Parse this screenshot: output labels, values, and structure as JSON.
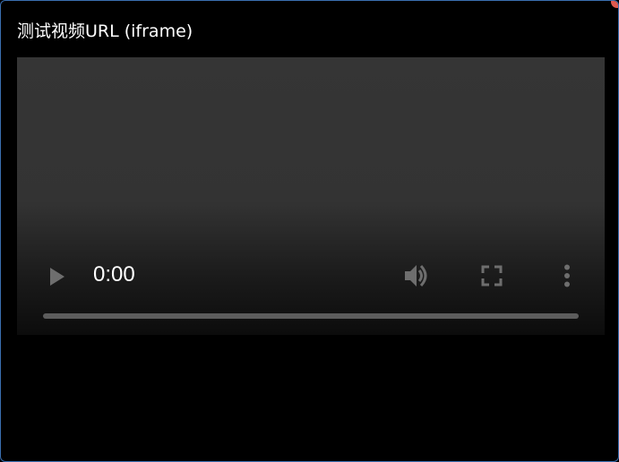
{
  "window": {
    "title": "测试视频URL (iframe)"
  },
  "player": {
    "current_time": "0:00",
    "progress": 0,
    "icons": {
      "play": "play-icon",
      "volume": "volume-icon",
      "fullscreen": "fullscreen-icon",
      "more": "more-options-icon"
    }
  }
}
